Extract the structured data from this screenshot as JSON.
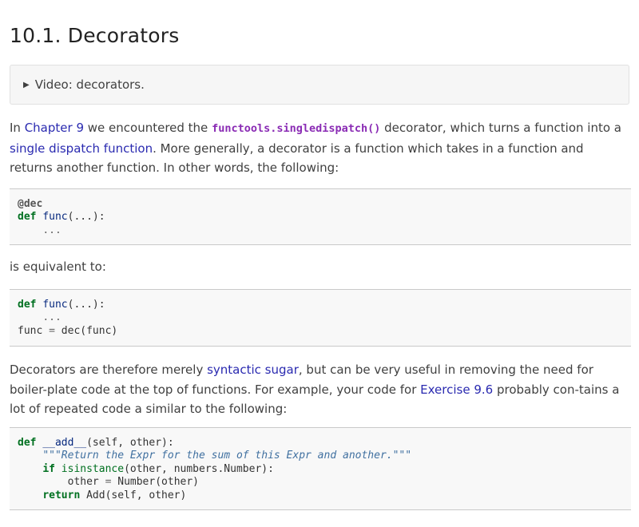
{
  "heading": "10.1. Decorators",
  "details": {
    "label": "Video: decorators."
  },
  "para1": {
    "t1": "In ",
    "link_chapter": "Chapter 9",
    "t2": " we encountered the ",
    "code_link": "functools.singledispatch()",
    "t3": " decorator, which turns a function into a ",
    "link_single_dispatch": "single dispatch function",
    "t4": ". More generally, a decorator is a function which takes in a function and returns another function. In other words, the following:"
  },
  "code1": {
    "decorator": "@dec",
    "def_kw": "def",
    "func_name": "func",
    "args": "(...):",
    "body": "...",
    "indent": "    "
  },
  "para2": {
    "text": "is equivalent to:"
  },
  "code2": {
    "def_kw": "def",
    "func_name": "func",
    "args": "(...):",
    "body": "...",
    "indent": "    ",
    "assign_lhs": "func",
    "assign_op": "=",
    "assign_rhs": "dec(func)"
  },
  "para3": {
    "t1": "Decorators are therefore merely ",
    "link_sugar": "syntactic sugar",
    "t2": ", but can be very useful in removing the need for boiler-plate code at the top of functions. For example, your code for ",
    "link_exercise": "Exercise 9.6",
    "t3": " probably con-tains a lot of repeated code a similar to the following:"
  },
  "code3": {
    "def_kw": "def",
    "func_name": "__add__",
    "sig": "(self, other):",
    "docstring": "\"\"\"Return the Expr for the sum of this Expr and another.\"\"\"",
    "if_kw": "if",
    "isinstance": "isinstance",
    "if_rest": "(other, numbers.Number):",
    "assign_lhs": "other",
    "assign_op": "=",
    "assign_rhs": "Number(other)",
    "return_kw": "return",
    "return_rest": "Add(self, other)",
    "indent1": "    ",
    "indent2": "        "
  }
}
